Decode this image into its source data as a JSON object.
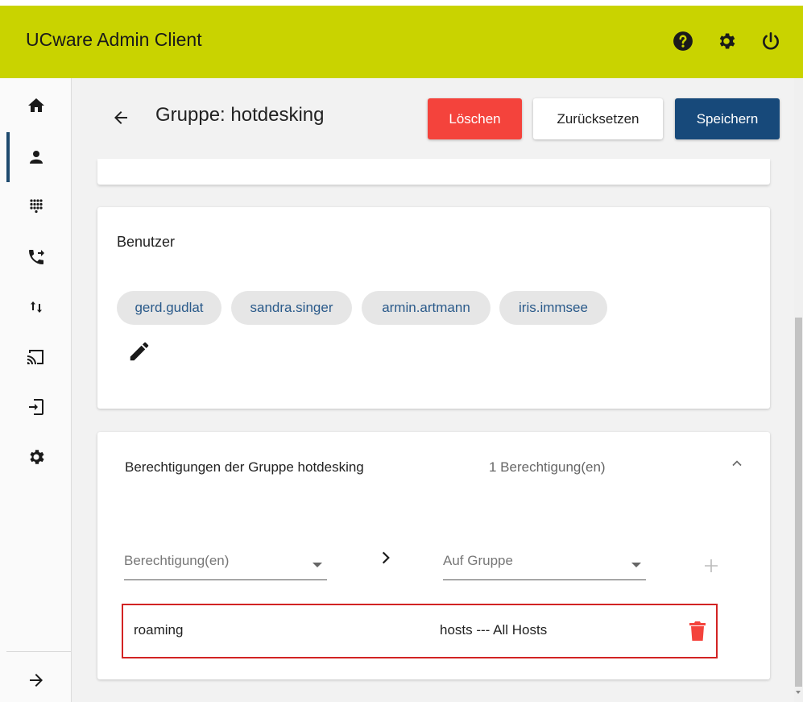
{
  "header": {
    "title": "UCware Admin Client",
    "icons": [
      "help-icon",
      "gear-icon",
      "power-icon"
    ]
  },
  "sidebar": {
    "items": [
      {
        "name": "home",
        "icon": "home-icon"
      },
      {
        "name": "users",
        "icon": "person-icon",
        "active": true
      },
      {
        "name": "dialpad",
        "icon": "dialpad-icon"
      },
      {
        "name": "call-forward",
        "icon": "call-forward-icon"
      },
      {
        "name": "transfer",
        "icon": "transfer-arrows-icon"
      },
      {
        "name": "cast",
        "icon": "cast-icon"
      },
      {
        "name": "login",
        "icon": "login-icon"
      },
      {
        "name": "settings",
        "icon": "gear-icon"
      }
    ],
    "footer_icon": "arrow-right-icon"
  },
  "page": {
    "title": "Gruppe: hotdesking",
    "buttons": {
      "delete": "Löschen",
      "reset": "Zurücksetzen",
      "save": "Speichern"
    }
  },
  "users_card": {
    "title": "Benutzer",
    "users": [
      "gerd.gudlat",
      "sandra.singer",
      "armin.artmann",
      "iris.immsee"
    ]
  },
  "permissions_card": {
    "title": "Berechtigungen der Gruppe hotdesking",
    "count_label": "1 Berechtigung(en)",
    "permission_select_placeholder": "Berechtigung(en)",
    "group_select_placeholder": "Auf Gruppe",
    "rows": [
      {
        "permission": "roaming",
        "target": "hosts --- All Hosts"
      }
    ]
  },
  "colors": {
    "header_bg": "#c9d300",
    "delete": "#f4433c",
    "save": "#17497a",
    "chip_text": "#2a5a8a",
    "trash": "#f4433c",
    "highlight_border": "#d22323"
  }
}
